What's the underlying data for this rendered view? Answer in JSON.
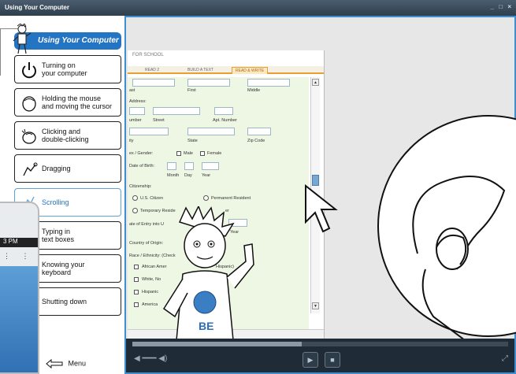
{
  "window": {
    "title": "Using Your Computer",
    "controls": "_ □ ×"
  },
  "app_button": {
    "label": "Using Your Computer"
  },
  "menu": {
    "items": [
      {
        "label": "Turning on\nyour computer",
        "icon": "power-icon"
      },
      {
        "label": "Holding the mouse\nand moving the cursor",
        "icon": "hand-mouse-icon"
      },
      {
        "label": "Clicking and\ndouble-clicking",
        "icon": "mouse-click-icon"
      },
      {
        "label": "Dragging",
        "icon": "drag-hand-icon"
      },
      {
        "label": "Scrolling",
        "icon": "scroll-icon"
      },
      {
        "label": "Typing in\ntext boxes",
        "icon": "keyboard-typing-icon"
      },
      {
        "label": "Knowing your\nkeyboard",
        "icon": "keyboard-icon"
      },
      {
        "label": "Shutting down",
        "icon": "shutdown-icon"
      }
    ],
    "footer_label": "Menu"
  },
  "phone": {
    "status_time": "3 PM"
  },
  "document": {
    "header": "FOR SCHOOL",
    "tabs": [
      "READ 2",
      "BUILD A TEXT",
      "READ & WRITE"
    ],
    "selected_tab": "READ & WRITE",
    "labels": {
      "last": "ast",
      "first": "First",
      "middle": "Middle",
      "address": "Address:",
      "number": "umber",
      "street": "Street",
      "apt": "Apt. Number",
      "city": "ity",
      "state": "State",
      "zip": "Zip Code",
      "sex": "ex / Gender:",
      "male": "Male",
      "female": "Female",
      "dob": "Date of Birth:",
      "month": "Month",
      "day": "Day",
      "year": "Year",
      "citizenship": "Citizenship:",
      "us_citizen": "U.S. Citizen",
      "perm_resident": "Permanent Resident",
      "temp_resident": "Temporary Reside",
      "temp_resident_suffix": "er",
      "entry": "ate of Entry into U",
      "entry_year": "Year",
      "origin": "Country of Origin:",
      "race": "Race / Ethnicity: (Check",
      "african": "African Amer",
      "hispanic_suffix": "Hispanic)",
      "white": "White, No",
      "hispanic": "Hispanic",
      "american": "America"
    },
    "mascot_label": "BE"
  },
  "player": {
    "progress": 0.45
  },
  "colors": {
    "accent": "#2474c4",
    "border": "#3d8fd1",
    "form_bg": "#eef6e4",
    "tab_accent": "#e9a030"
  }
}
